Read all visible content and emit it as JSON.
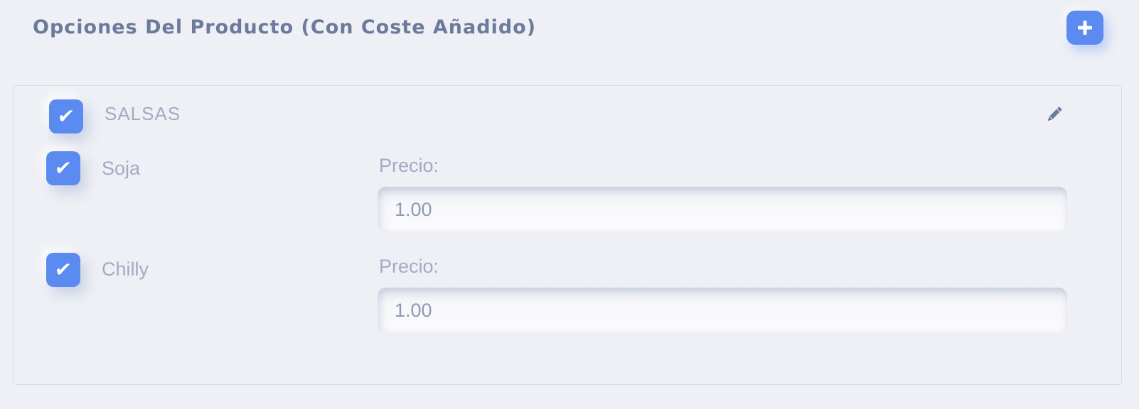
{
  "section": {
    "title": "Opciones Del Producto (Con Coste Añadido)",
    "add_icon": "plus-icon"
  },
  "group": {
    "name": "SALSAS",
    "checked": true,
    "edit_icon": "pencil-icon",
    "options": [
      {
        "label": "Soja",
        "checked": true,
        "price_label": "Precio:",
        "price_value": "1.00"
      },
      {
        "label": "Chilly",
        "checked": true,
        "price_label": "Precio:",
        "price_value": "1.00"
      }
    ]
  },
  "colors": {
    "accent": "#5b8af0",
    "background": "#eef0f5",
    "title_text": "#6c7a9c",
    "muted_text": "#a3abc3"
  }
}
